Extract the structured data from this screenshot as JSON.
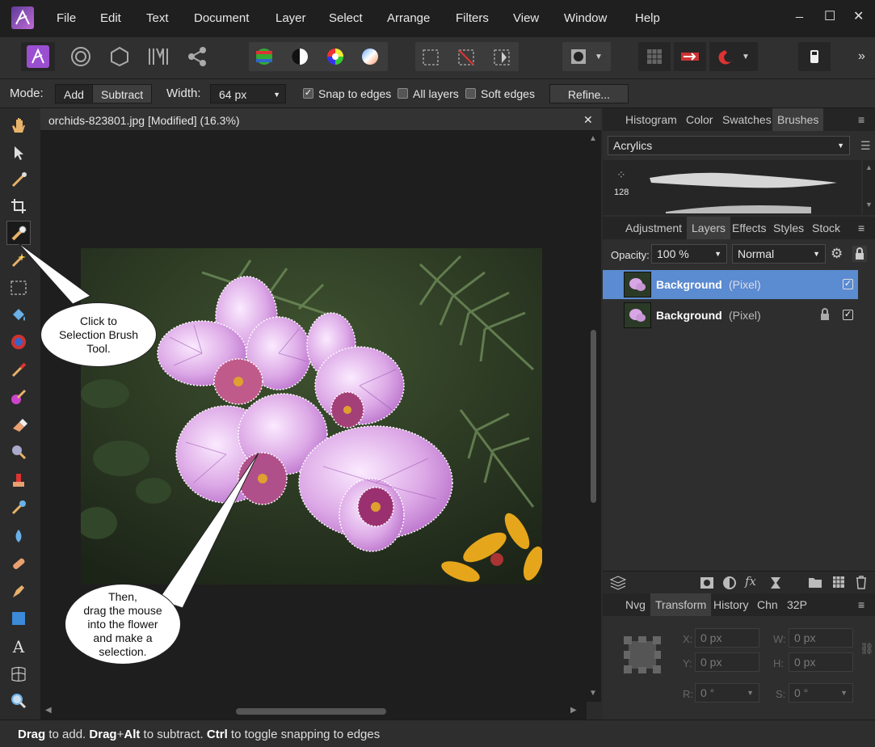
{
  "menubar": {
    "items": [
      "File",
      "Edit",
      "Text",
      "Document",
      "Layer",
      "Select",
      "Arrange",
      "Filters",
      "View",
      "Window",
      "Help"
    ]
  },
  "context_bar": {
    "mode_label": "Mode:",
    "mode_add": "Add",
    "mode_subtract": "Subtract",
    "width_label": "Width:",
    "width_value": "64 px",
    "snap_label": "Snap to edges",
    "all_layers_label": "All layers",
    "soft_edges_label": "Soft edges",
    "refine_label": "Refine..."
  },
  "document": {
    "tab_title": "orchids-823801.jpg [Modified] (16.3%)",
    "close": "✕"
  },
  "callouts": {
    "first": [
      "Click to",
      "Selection Brush",
      "Tool."
    ],
    "second": [
      "Then,",
      "drag the mouse",
      "into the flower",
      "and make a",
      "selection."
    ]
  },
  "top_panel": {
    "tabs": [
      "Histogram",
      "Color",
      "Swatches",
      "Brushes"
    ],
    "active_tab": "Brushes",
    "category": "Acrylics",
    "brush_size": "128"
  },
  "layers_panel": {
    "tabs": [
      "Adjustment",
      "Layers",
      "Effects",
      "Styles",
      "Stock"
    ],
    "active_tab": "Layers",
    "opacity_label": "Opacity:",
    "opacity_value": "100 %",
    "blend_mode": "Normal",
    "layers": [
      {
        "name": "Background",
        "type": "(Pixel)",
        "selected": true,
        "locked": false
      },
      {
        "name": "Background",
        "type": "(Pixel)",
        "selected": false,
        "locked": true
      }
    ]
  },
  "transform_panel": {
    "tabs": [
      "Nvg",
      "Transform",
      "History",
      "Chn",
      "32P"
    ],
    "active_tab": "Transform",
    "x_label": "X:",
    "x_value": "0 px",
    "y_label": "Y:",
    "y_value": "0 px",
    "w_label": "W:",
    "w_value": "0 px",
    "h_label": "H:",
    "h_value": "0 px",
    "r_label": "R:",
    "r_value": "0 °",
    "s_label": "S:",
    "s_value": "0 °"
  },
  "status": {
    "k1": "Drag",
    "t1": " to add. ",
    "k2": "Drag",
    "t2": "+",
    "k3": "Alt",
    "t3": " to subtract. ",
    "k4": "Ctrl",
    "t4": " to toggle snapping to edges"
  },
  "colors": {
    "accent_selected_layer": "#5b8bd0",
    "app_brand": "#8a4fc0"
  }
}
